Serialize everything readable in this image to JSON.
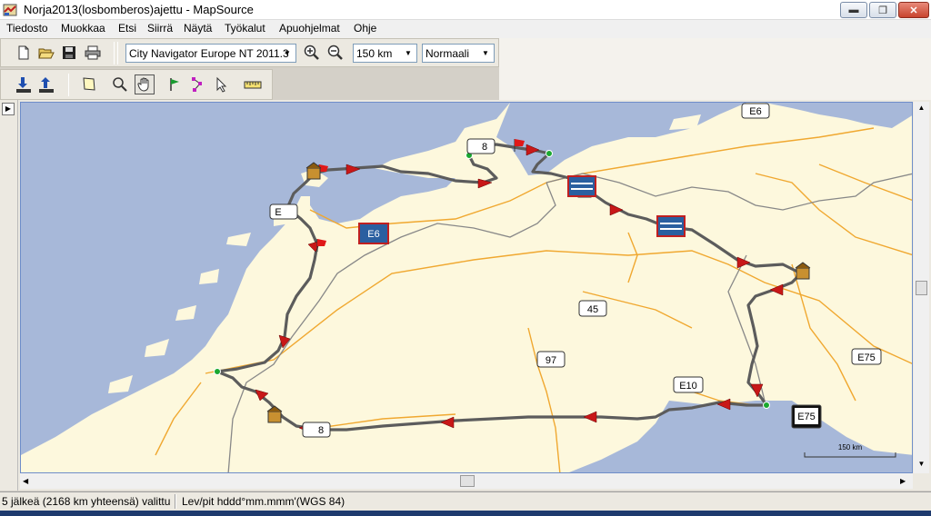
{
  "window": {
    "title": "Norja2013(losbomberos)ajettu - MapSource",
    "controls": {
      "minimize": "▬",
      "maximize": "❐",
      "close": "✕"
    }
  },
  "menu": [
    "Tiedosto",
    "Muokkaa",
    "Etsi",
    "Siirrä",
    "Näytä",
    "Työkalut",
    "Apuohjelmat",
    "Ohje"
  ],
  "toolbar": {
    "map_product": "City Navigator Europe NT 2011.3",
    "zoom_scale": "150 km",
    "detail_level": "Normaali"
  },
  "map": {
    "colors": {
      "water": "#a7b8d9",
      "land": "#fdf8dd",
      "route": "#5c5c5c",
      "road": "#f0a830",
      "border": "#888888",
      "flag": "#e01818"
    },
    "road_labels": {
      "e6_top": "E6",
      "e6_left": "E",
      "e6_sign": "E6",
      "route_45": "45",
      "route_97": "97",
      "e10": "E10",
      "e75_right": "E75",
      "e75_sign": "E75",
      "route_8": "8",
      "route_bottom": "8"
    },
    "scale_bar": "150 km"
  },
  "status": {
    "selection": "5 jälkeä (2168 km yhteensä) valittu",
    "coords_format": "Lev/pit hddd°mm.mmm'(WGS 84)"
  }
}
